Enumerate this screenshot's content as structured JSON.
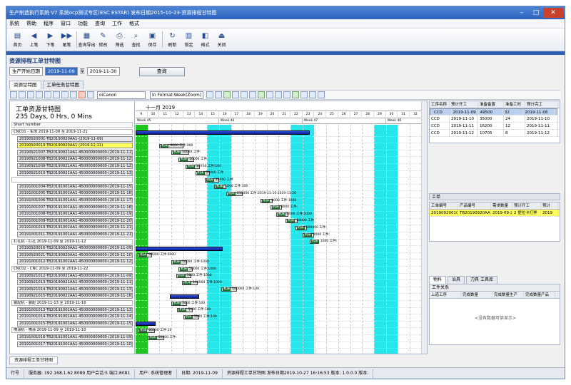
{
  "window": {
    "title": "生产制造执行系统 V7 系统ocp测试专区(ESC ESTAR) 发布日期2015-10-23-资源排程甘特图",
    "min": "–",
    "max": "□",
    "close": "✕"
  },
  "menu": [
    "系统",
    "帮助",
    "程序",
    "窗口",
    "功能",
    "查询",
    "工作",
    "格式"
  ],
  "toolbar": [
    {
      "icon": "doc-new-icon",
      "glyph": "▤",
      "label": "首页"
    },
    {
      "icon": "prev-icon",
      "glyph": "◀",
      "label": "上笔"
    },
    {
      "icon": "next-icon",
      "glyph": "▶",
      "label": "下笔"
    },
    {
      "icon": "last-icon",
      "glyph": "▶▶",
      "label": "尾笔"
    },
    {
      "icon": "export-icon",
      "glyph": "▦",
      "label": "查询导出"
    },
    {
      "icon": "edit-icon",
      "glyph": "✎",
      "label": "修改"
    },
    {
      "icon": "print-icon",
      "glyph": "⎙",
      "label": "筛选"
    },
    {
      "icon": "find-icon",
      "glyph": "⌕",
      "label": "查找"
    },
    {
      "icon": "save-icon",
      "glyph": "▣",
      "label": "保存"
    },
    {
      "icon": "refresh-icon",
      "glyph": "↻",
      "label": "刷新"
    },
    {
      "icon": "lock-icon",
      "glyph": "▥",
      "label": "锁定"
    },
    {
      "icon": "format-icon",
      "glyph": "◧",
      "label": "格式"
    },
    {
      "icon": "exit-icon",
      "glyph": "⏏",
      "label": "关闭"
    }
  ],
  "section": "资源排程工单甘特图",
  "filter": {
    "field": "生产开始日期",
    "from": "2019-11-09",
    "to_label": "至",
    "to": "2019-11-30",
    "query": "查询"
  },
  "tabs": [
    "资源甘特图",
    "工单任务甘特图"
  ],
  "gantt_tool": {
    "select1": "oiCanon",
    "select2": "In Format:Week(Zoom)"
  },
  "gantt": {
    "title": "工单资源甘特图",
    "duration": "235 Days, 0 Hrs, 0 Mins",
    "col_header": "Short number",
    "month": "十一月 2019",
    "weeks": [
      "Week 45",
      "Week 46",
      "Week 47",
      "Week 48"
    ],
    "rows": [
      {
        "text": "CNC01 - 车床 2019-11-09 至 2019-11-21",
        "grp": true
      },
      {
        "text": "20190920001-TB20190920AA1-(2019-11-09)"
      },
      {
        "text": "20190920019-TB20190920AA1 (2019-11-11)",
        "yel": true
      },
      {
        "text": "20190921007-TB20190921AA1-450000000000-(2019-11-11)"
      },
      {
        "text": "20190921008-TB20190921AA1-450000000000-(2019-11-12)"
      },
      {
        "text": "20190921009-TB20190921AA1-450000000000-(2019-11-12)"
      },
      {
        "text": "20190921010-TB20190921AA1-450000000000-(2019-11-13)"
      },
      {
        "text": "",
        "grp": true
      },
      {
        "text": "20191001004-TB20191001AA1-450000000000-(2019-11-15)"
      },
      {
        "text": "20191001005-TB20191001AA1-450000000000-(2019-11-16)"
      },
      {
        "text": "20191001006-TB20191001AA1-450000000000-(2019-11-17)"
      },
      {
        "text": "20191001007-TB20191001AA1-450000000000-(2019-11-18)"
      },
      {
        "text": "20191001008-TB20191001AA1-450000000000-(2019-11-19)"
      },
      {
        "text": "20191001009-TB20191001AA1-450000000000-(2019-11-20)"
      },
      {
        "text": "20191001010-TB20191001AA1-450000000000-(2019-11-21)"
      },
      {
        "text": "20191001011-TB20191001AA1-450000000000-(2019-11-21)"
      },
      {
        "text": "打孔机 - 打孔 2019-11-09 至 2019-11-12",
        "grp": true
      },
      {
        "text": "20190920016-TB20190920AA1-450000000000-(2019-11-09)"
      },
      {
        "text": "20190920021-TB20190920AA1-450000000000-(2019-11-10)"
      },
      {
        "text": "20191001012-TB20191001AA1-450000000000-(2019-11-12)"
      },
      {
        "text": "CNC02 - CNC 2019-11-09 至 2019-11-22",
        "grp": true
      },
      {
        "text": "20190921012-TB20190921AA1-450000000000-(2019-11-09)"
      },
      {
        "text": "20190921013-TB20190921AA1-450000000000-(2019-11-11)"
      },
      {
        "text": "20190921014-TB20190921AA1-450000000000-(2019-11-13)"
      },
      {
        "text": "20190921015-TB20190921AA1-450000000000-(2019-11-16)"
      },
      {
        "text": "装配机 - 装配 2019-11-13 至 2019-11-16",
        "grp": true
      },
      {
        "text": "20191001013-TB20191001AA1-450000000000-(2019-11-13)"
      },
      {
        "text": "20191001014-TB20191001AA1-450000000000-(2019-11-14)"
      },
      {
        "text": "20191001015-TB20191001AA1-450000000000-(2019-11-15)"
      },
      {
        "text": "喷涂机 - 喷涂 2019-11-09 至 2019-11-10",
        "grp": true
      },
      {
        "text": "20191001016-TB20191001AA1-450000000000-(2019-11-09)"
      },
      {
        "text": "20191001017-TB20191001AA1-450000000000-(2019-11-10)"
      }
    ],
    "bars": [
      {
        "row": 2,
        "start": 2.0,
        "dur": 2.0,
        "label": "9000 工件:900",
        "name": "机床"
      },
      {
        "row": 3,
        "start": 3.0,
        "dur": 1.5,
        "label": "10000 工件:",
        "name": "机床"
      },
      {
        "row": 4,
        "start": 3.6,
        "dur": 1.3,
        "label": "10000 工件",
        "name": "机床"
      },
      {
        "row": 5,
        "start": 4.2,
        "dur": 1.2,
        "label": "10700 工件:100",
        "name": "机床"
      },
      {
        "row": 6,
        "start": 5.0,
        "dur": 1.2,
        "label": "20000 工件",
        "name": "机床"
      },
      {
        "row": 7,
        "start": 5.8,
        "dur": 1.2,
        "label": "20000 工件",
        "name": "机床"
      },
      {
        "row": 8,
        "start": 6.6,
        "dur": 1.0,
        "label": "1000 工件:100",
        "name": "机床"
      },
      {
        "row": 9,
        "start": 7.6,
        "dur": 1.4,
        "label": "215000 工件:2019-11-10-2019-11-20",
        "name": "机床"
      },
      {
        "row": 10,
        "start": 10.5,
        "dur": 1.0,
        "label": "8000 工件:1000",
        "name": "机床"
      },
      {
        "row": 11,
        "start": 11.3,
        "dur": 1.0,
        "label": "8000 工件:",
        "name": "机床"
      },
      {
        "row": 12,
        "start": 11.8,
        "dur": 1.0,
        "label": "8000 工件:1000",
        "name": "机床"
      },
      {
        "row": 13,
        "start": 12.6,
        "dur": 1.0,
        "label": "38000 工件:",
        "name": "机床"
      },
      {
        "row": 14,
        "start": 13.4,
        "dur": 1.0,
        "label": "100000 工件:",
        "name": "机床"
      },
      {
        "row": 15,
        "start": 14.0,
        "dur": 1.0,
        "label": "1000 工件:",
        "name": "机床"
      },
      {
        "row": 16,
        "start": 14.6,
        "dur": 0.8,
        "label": "1000 工件:",
        "name": "机床"
      },
      {
        "row": 18,
        "start": 0.2,
        "dur": 1.2,
        "label": "00000 工件:0000",
        "name": "机床"
      },
      {
        "row": 19,
        "start": 3.0,
        "dur": 1.3,
        "label": "10000 工件:1000",
        "name": "机床"
      },
      {
        "row": 20,
        "start": 3.6,
        "dur": 1.2,
        "label": "50000 工件:1000",
        "name": "机床"
      },
      {
        "row": 21,
        "start": 3.4,
        "dur": 1.3,
        "label": "5000 工件:1000",
        "name": "机床"
      },
      {
        "row": 22,
        "start": 3.9,
        "dur": 1.3,
        "label": "100000 工件:1000",
        "name": "机床"
      },
      {
        "row": 23,
        "start": 7.2,
        "dur": 1.3,
        "label": "100000 工件:100",
        "name": "机床"
      },
      {
        "row": 25,
        "start": 3.0,
        "dur": 1.3,
        "label": "5000 工件:100",
        "name": "机床"
      },
      {
        "row": 26,
        "start": 3.5,
        "dur": 1.3,
        "label": "5000 工件:100",
        "name": "机床"
      },
      {
        "row": 27,
        "start": 4.0,
        "dur": 1.3,
        "label": "5000 工件:100",
        "name": "机床"
      },
      {
        "row": 29,
        "start": 0.2,
        "dur": 1.4,
        "label": "80000 工件:10",
        "name": "机床"
      },
      {
        "row": 30,
        "start": 1.0,
        "dur": 1.4,
        "label": "50000 工件:",
        "name": "机床"
      }
    ],
    "summaries": [
      {
        "row": 0,
        "start": 0.0,
        "dur": 14.6
      },
      {
        "row": 17,
        "start": 0.0,
        "dur": 7.3
      },
      {
        "row": 24,
        "start": 2.9,
        "dur": 2.4
      },
      {
        "row": 28,
        "start": 0.0,
        "dur": 1.7
      }
    ]
  },
  "res_table": {
    "headers": [
      "工序名称",
      "预计开工",
      "准备备置",
      "准备工时",
      "预计完工"
    ],
    "rows": [
      [
        "CCD",
        "2019-11-09",
        "49500",
        "32",
        "2019-11-08"
      ],
      [
        "CCD",
        "2019-11-10",
        "35000",
        "24",
        "2019-11-10"
      ],
      [
        "CCD",
        "2019-11-11",
        "16200",
        "12",
        "2019-11-11"
      ],
      [
        "CCD",
        "2019-11-12",
        "10705",
        "8",
        "2019-11-12"
      ]
    ]
  },
  "wo_panel": {
    "title": "工单",
    "headers": [
      "工单编号",
      "产品编号",
      "需求数量",
      "预计开工",
      "预计"
    ],
    "rows": [
      [
        "20190920010",
        "TB20190920AA1",
        "2019-09-29",
        "2 提拉卡打样",
        "2019"
      ]
    ]
  },
  "bottom_tabs": [
    "物料",
    "治具",
    "刀具 工具库"
  ],
  "plan": {
    "title": "工件关系",
    "headers": [
      "上道工序",
      "完成数量",
      "完成数量生产",
      "完成数量产品"
    ],
    "empty": "<没有数据可供显示>"
  },
  "doc_tab": "资源排程工单甘特图",
  "status": [
    "行号",
    "服务器: 192.168.1.62 8089 用户会话:5 端口:8081",
    "用户: 系统管理者",
    "日期: 2019-11-09",
    "资源排程工单甘特图 发布日期2019-10-27 16:16:53 版本: 1.0.0.0 版本:"
  ]
}
